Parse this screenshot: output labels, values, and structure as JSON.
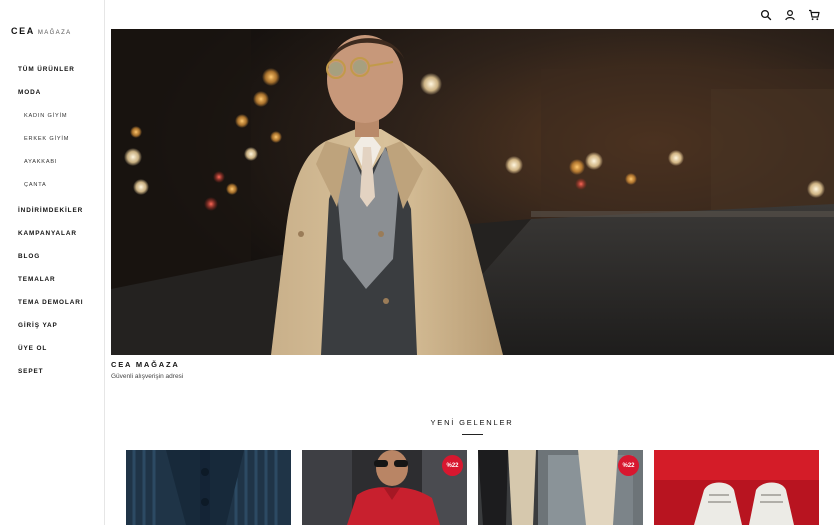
{
  "brand": {
    "name": "CEA",
    "subtitle": "MAĞAZA"
  },
  "nav": {
    "items": [
      {
        "label": "TÜM ÜRÜNLER"
      },
      {
        "label": "MODA"
      },
      {
        "label": "KADIN GİYİM"
      },
      {
        "label": "ERKEK GİYİM"
      },
      {
        "label": "AYAKKABI"
      },
      {
        "label": "ÇANTA"
      },
      {
        "label": "İNDİRİMDEKİLER"
      },
      {
        "label": "KAMPANYALAR"
      },
      {
        "label": "BLOG"
      },
      {
        "label": "TEMALAR"
      },
      {
        "label": "TEMA DEMOLARI"
      },
      {
        "label": "GİRİŞ YAP"
      },
      {
        "label": "ÜYE OL"
      },
      {
        "label": "SEPET"
      }
    ]
  },
  "header": {
    "icons": [
      "search-icon",
      "user-icon",
      "cart-icon"
    ]
  },
  "hero": {
    "title": "CEA MAĞAZA",
    "subtitle": "Güvenli alışverişin adresi"
  },
  "new_arrivals": {
    "title": "YENİ GELENLER",
    "products": [
      {
        "badge": ""
      },
      {
        "badge": "%22"
      },
      {
        "badge": "%22"
      },
      {
        "badge": ""
      }
    ]
  },
  "colors": {
    "badge": "#d8172f",
    "text": "#111111",
    "sidebar_border": "#e6e6e6"
  }
}
